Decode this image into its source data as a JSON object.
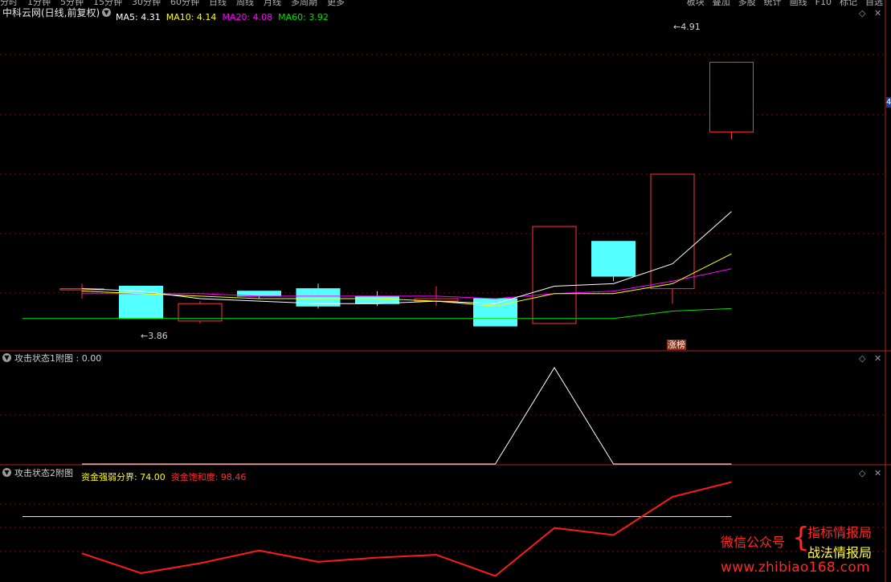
{
  "toolbar": {
    "menu_items": [
      "分时",
      "1分钟",
      "5分钟",
      "15分钟",
      "30分钟",
      "60分钟",
      "日线",
      "周线",
      "月线",
      "多周期",
      "更多"
    ],
    "right_buttons": [
      "板块",
      "叠加",
      "多股",
      "统计",
      "画线",
      "F10",
      "标记",
      "自选"
    ]
  },
  "main_panel": {
    "stock_title": "中科云网(日线,前复权)",
    "ma_legend": [
      {
        "label": "MA5: 4.31",
        "color": "#ffffff"
      },
      {
        "label": "MA10: 4.14",
        "color": "#ffff00"
      },
      {
        "label": "MA20: 4.08",
        "color": "#ff00ff"
      },
      {
        "label": "MA60: 3.92",
        "color": "#00e000"
      }
    ],
    "high_label": "4.91",
    "low_label": "3.86",
    "badge": "涨榜",
    "right_axis_marker": "4"
  },
  "panel_1": {
    "title": "攻击状态1附图 : 0.00"
  },
  "panel_2": {
    "title": "攻击状态2附图",
    "legend": [
      {
        "label": "资金强弱分界: 74.00",
        "color": "#ffff00"
      },
      {
        "label": "资金饱和度: 98.46",
        "color": "#ff3030"
      }
    ]
  },
  "watermark": {
    "left_text": "微信公众号",
    "right_lines": [
      "指标情报局",
      "战法情报局"
    ],
    "url": "www.zhibiao168.com"
  },
  "colors": {
    "up": "#ff3232",
    "down": "#54ffff",
    "grid": "#8b0000",
    "ma5": "#ffffff",
    "ma10": "#ffff00",
    "ma20": "#ff00ff",
    "ma60": "#00e000"
  },
  "chart_data": {
    "type": "candlestick",
    "candles": [
      {
        "open": 4.0,
        "close": 4.0,
        "high": 4.02,
        "low": 3.96
      },
      {
        "open": 4.01,
        "close": 3.88,
        "high": 4.01,
        "low": 3.88
      },
      {
        "open": 3.87,
        "close": 3.94,
        "high": 3.95,
        "low": 3.86
      },
      {
        "open": 3.99,
        "close": 3.97,
        "high": 3.98,
        "low": 3.96
      },
      {
        "open": 4.0,
        "close": 3.93,
        "high": 4.02,
        "low": 3.92
      },
      {
        "open": 3.97,
        "close": 3.94,
        "high": 3.99,
        "low": 3.93
      },
      {
        "open": 3.95,
        "close": 3.96,
        "high": 4.01,
        "low": 3.93
      },
      {
        "open": 3.96,
        "close": 3.85,
        "high": 3.96,
        "low": 3.85
      },
      {
        "open": 3.86,
        "close": 4.25,
        "high": 4.25,
        "low": 3.86
      },
      {
        "open": 4.19,
        "close": 4.05,
        "high": 4.19,
        "low": 4.03
      },
      {
        "open": 4.0,
        "close": 4.46,
        "high": 4.46,
        "low": 3.94
      },
      {
        "open": 4.63,
        "close": 4.91,
        "high": 4.91,
        "low": 4.6
      }
    ],
    "ma5": [
      4.0,
      3.99,
      3.96,
      3.95,
      3.94,
      3.94,
      3.95,
      3.94,
      4.01,
      4.02,
      4.1,
      4.31
    ],
    "ma10": [
      3.99,
      3.98,
      3.97,
      3.96,
      3.96,
      3.96,
      3.95,
      3.93,
      3.98,
      3.98,
      4.02,
      4.14
    ],
    "ma20": [
      3.98,
      3.98,
      3.98,
      3.97,
      3.97,
      3.97,
      3.97,
      3.96,
      3.98,
      3.99,
      4.03,
      4.08
    ],
    "ma60": [
      3.88,
      3.88,
      3.88,
      3.88,
      3.88,
      3.88,
      3.88,
      3.88,
      3.88,
      3.88,
      3.91,
      3.92
    ],
    "ind1": [
      0,
      0,
      0,
      0,
      0,
      0,
      0,
      0,
      1,
      0,
      0,
      0
    ],
    "ind2_line": 74.0,
    "ind2": [
      48,
      34,
      41,
      50,
      42,
      45,
      47,
      32,
      66,
      61,
      88,
      98.46
    ]
  }
}
